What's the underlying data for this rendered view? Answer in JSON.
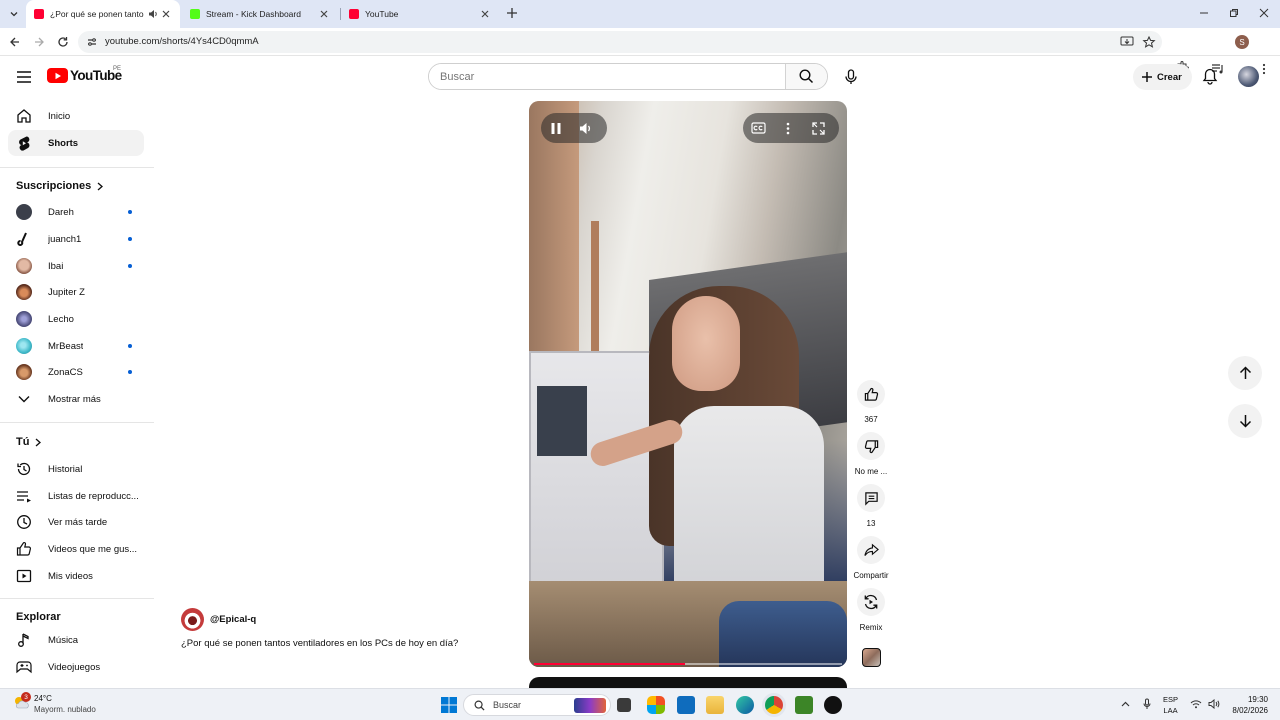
{
  "browser": {
    "tabs": [
      {
        "title": "¿Por qué se ponen tantos ventiladores en los PCs de hoy en día?",
        "active": true,
        "favicon_color": "#ff0033",
        "audio": true
      },
      {
        "title": "Stream - Kick Dashboard",
        "active": false,
        "favicon_color": "#53fc18",
        "audio": false
      },
      {
        "title": "YouTube",
        "active": false,
        "favicon_color": "#ff0033",
        "audio": false
      }
    ],
    "url": "youtube.com/shorts/4Ys4CD0qmmA",
    "profile_initial": "S"
  },
  "masthead": {
    "logo_text": "YouTube",
    "region": "PE",
    "search_placeholder": "Buscar",
    "create_label": "Crear"
  },
  "sidebar": {
    "main": [
      {
        "label": "Inicio",
        "icon": "home-icon",
        "active": false
      },
      {
        "label": "Shorts",
        "icon": "shorts-icon",
        "active": true
      }
    ],
    "subscriptions_title": "Suscripciones",
    "subscriptions": [
      {
        "label": "Dareh",
        "new": true,
        "color": "#3b3f4a"
      },
      {
        "label": "juanch1",
        "new": true,
        "color": "#111111"
      },
      {
        "label": "Ibai",
        "new": true,
        "color": "#c99a86"
      },
      {
        "label": "Jupiter Z",
        "new": false,
        "color": "#5a2d1e"
      },
      {
        "label": "Lecho",
        "new": false,
        "color": "#4b4c7a"
      },
      {
        "label": "MrBeast",
        "new": true,
        "color": "#3fb9c9"
      },
      {
        "label": "ZonaCS",
        "new": true,
        "color": "#6b3a22"
      }
    ],
    "show_more": "Mostrar más",
    "you_title": "Tú",
    "you": [
      {
        "label": "Historial",
        "icon": "history-icon"
      },
      {
        "label": "Listas de reproducc...",
        "icon": "playlists-icon"
      },
      {
        "label": "Ver más tarde",
        "icon": "watch-later-icon"
      },
      {
        "label": "Videos que me gus...",
        "icon": "liked-videos-icon"
      },
      {
        "label": "Mis videos",
        "icon": "my-videos-icon"
      }
    ],
    "explore_title": "Explorar",
    "explore": [
      {
        "label": "Música",
        "icon": "music-icon"
      },
      {
        "label": "Videojuegos",
        "icon": "gaming-icon"
      }
    ]
  },
  "short": {
    "channel": "@Epical-q",
    "title": "¿Por qué se ponen tantos ventiladores en los PCs de hoy en día?",
    "progress": 0.49,
    "actions": {
      "like_count": "367",
      "dislike_label": "No me ...",
      "comments_count": "13",
      "share_label": "Compartir",
      "remix_label": "Remix"
    }
  },
  "taskbar": {
    "weather_temp": "24°C",
    "weather_desc": "Mayorm. nublado",
    "weather_badge": "3",
    "search_label": "Buscar",
    "lang_top": "ESP",
    "lang_bottom": "LAA",
    "time": "19:30",
    "date": "8/02/2026"
  }
}
